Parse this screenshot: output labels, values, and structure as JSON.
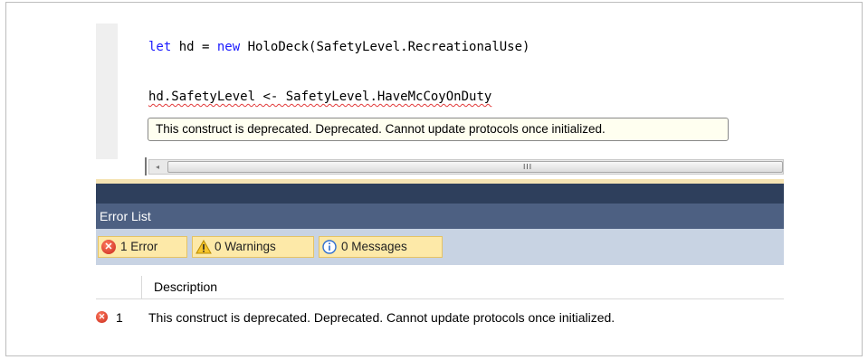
{
  "editor": {
    "line1": {
      "kw_let": "let",
      "ident": " hd = ",
      "kw_new": "new",
      "rest": " HoloDeck(SafetyLevel.RecreationalUse)"
    },
    "line2": {
      "target": "hd.SafetyLevel",
      "rest": " <- SafetyLevel.HaveMcCoyOnDuty"
    },
    "tooltip": "This construct is deprecated. Deprecated. Cannot update protocols once initialized."
  },
  "scrollbar": {
    "left_arrow": "◂",
    "grip": "III"
  },
  "error_list": {
    "title": "Error List",
    "filters": [
      {
        "icon": "error-icon",
        "label": "1 Error"
      },
      {
        "icon": "warning-icon",
        "label": "0 Warnings"
      },
      {
        "icon": "info-icon",
        "label": "0 Messages"
      }
    ],
    "columns": {
      "description": "Description"
    },
    "rows": [
      {
        "number": "1",
        "description": "This construct is deprecated. Deprecated. Cannot update protocols once initialized."
      }
    ]
  },
  "colors": {
    "keyword": "#1a1aff",
    "header_bg": "#4d6082",
    "toolbar_bg": "#c8d3e3",
    "filter_bg": "#fde9a8",
    "error_red": "#c8281a"
  }
}
